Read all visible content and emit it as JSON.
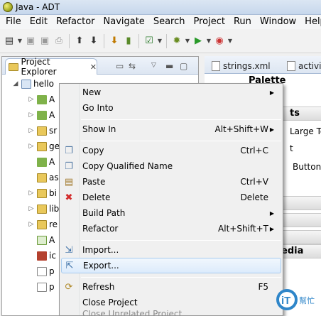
{
  "window": {
    "title": "Java - ADT"
  },
  "menubar": [
    "File",
    "Edit",
    "Refactor",
    "Navigate",
    "Search",
    "Project",
    "Run",
    "Window",
    "Help"
  ],
  "project_explorer": {
    "tab_label": "Project Explorer",
    "tree": [
      {
        "label": "hello",
        "expanded": true
      },
      {
        "label": "A"
      },
      {
        "label": "A"
      },
      {
        "label": "sr"
      },
      {
        "label": "ge"
      },
      {
        "label": "A"
      },
      {
        "label": "as"
      },
      {
        "label": "bi"
      },
      {
        "label": "lib"
      },
      {
        "label": "re"
      },
      {
        "label": "A"
      },
      {
        "label": "ic"
      },
      {
        "label": "p"
      },
      {
        "label": "p"
      }
    ]
  },
  "editor": {
    "tabs": [
      "strings.xml",
      "activit"
    ],
    "palette_title": "Palette",
    "palette_fragments": [
      "ts",
      "Large Te",
      "t",
      "Button"
    ],
    "palette_section": "edia"
  },
  "context_menu": {
    "items": [
      {
        "label": "New",
        "submenu": true
      },
      {
        "label": "Go Into"
      },
      {
        "separator": true
      },
      {
        "label": "Show In",
        "shortcut": "Alt+Shift+W",
        "submenu": true
      },
      {
        "separator": true
      },
      {
        "label": "Copy",
        "shortcut": "Ctrl+C",
        "icon": "copy-icon"
      },
      {
        "label": "Copy Qualified Name",
        "icon": "copy-qualified-icon"
      },
      {
        "label": "Paste",
        "shortcut": "Ctrl+V",
        "icon": "paste-icon"
      },
      {
        "label": "Delete",
        "shortcut": "Delete",
        "icon": "delete-icon"
      },
      {
        "label": "Build Path",
        "submenu": true
      },
      {
        "label": "Refactor",
        "shortcut": "Alt+Shift+T",
        "submenu": true
      },
      {
        "separator": true
      },
      {
        "label": "Import...",
        "icon": "import-icon"
      },
      {
        "label": "Export...",
        "icon": "export-icon",
        "highlighted": true
      },
      {
        "separator": true
      },
      {
        "label": "Refresh",
        "shortcut": "F5",
        "icon": "refresh-icon"
      },
      {
        "label": "Close Project"
      },
      {
        "label": "Close Unrelated Project",
        "disabled": true
      }
    ]
  },
  "watermark": {
    "text": "iT",
    "subtext": "幫忙"
  },
  "colors": {
    "highlight_border": "#a8cbee",
    "highlight_fill": "#dcebfc",
    "delete_red": "#d32a2a"
  }
}
